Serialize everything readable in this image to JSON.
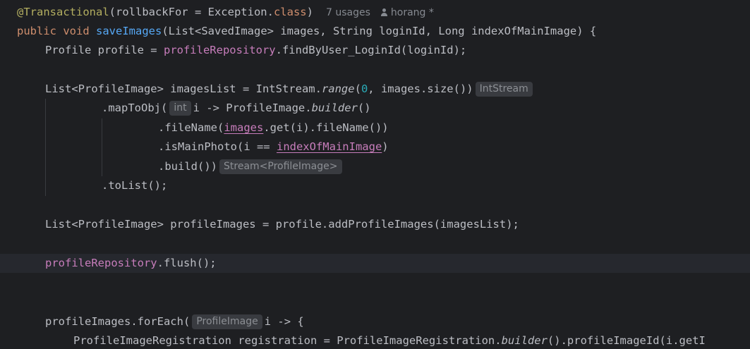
{
  "code": {
    "l1": {
      "annotation": "@Transactional",
      "args_open": "(rollbackFor = Exception.",
      "kw_class": "class",
      "args_close": ")",
      "usages": "7 usages",
      "author": "horang *"
    },
    "l2": {
      "kw_public": "public",
      "kw_void": "void",
      "method": "saveImages",
      "params": "(List<SavedImage> images, String loginId, Long indexOfMainImage) {"
    },
    "l3": {
      "a": "Profile profile = ",
      "field": "profileRepository",
      "b": ".findByUser_LoginId(loginId);"
    },
    "l5": {
      "a": "List<ProfileImage> imagesList = IntStream.",
      "static_call": "range",
      "b": "(",
      "zero": "0",
      "c": ", images.size())",
      "hint": "IntStream"
    },
    "l6": {
      "a": ".mapToObj(",
      "hint": "int",
      "b": "i -> ProfileImage.",
      "static_call": "builder",
      "c": "()"
    },
    "l7": {
      "a": ".fileName(",
      "captured": "images",
      "b": ".get(i).fileName())"
    },
    "l8": {
      "a": ".isMainPhoto(i == ",
      "captured": "indexOfMainImage",
      "b": ")"
    },
    "l9": {
      "a": ".build())",
      "hint": "Stream<ProfileImage>"
    },
    "l10": {
      "a": ".toList();"
    },
    "l12": {
      "a": "List<ProfileImage> profileImages = profile.addProfileImages(imagesList);"
    },
    "l14": {
      "field": "profileRepository",
      "a": ".flush();"
    },
    "l17": {
      "a": "profileImages.forEach(",
      "hint": "ProfileImage",
      "b": "i -> {"
    },
    "l18": {
      "a": "ProfileImageRegistration registration = ProfileImageRegistration.",
      "static_call": "builder",
      "b": "().profileImageId(i.getI"
    }
  },
  "theme": {
    "background": "#1e1f22",
    "text": "#bcbec4",
    "keyword": "#cf8e6d",
    "annotation": "#b3ae60",
    "method": "#56a8f5",
    "field": "#c77dbb",
    "number": "#2aacb8"
  }
}
